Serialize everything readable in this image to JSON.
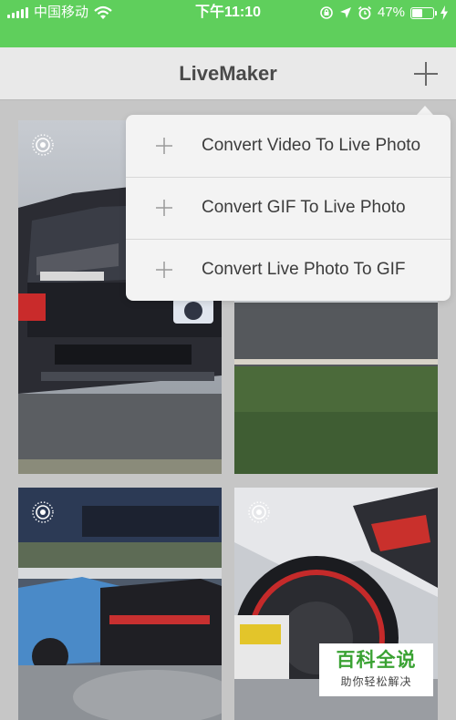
{
  "status_bar": {
    "carrier": "中国移动",
    "time": "下午11:10",
    "battery_percent": "47%",
    "battery_level": 0.47,
    "background_color": "#5fcf5c",
    "icons": [
      "signal-icon",
      "wifi-icon",
      "screen-lock-icon",
      "location-icon",
      "alarm-icon",
      "battery-icon",
      "charging-icon"
    ]
  },
  "nav": {
    "title": "LiveMaker",
    "add_icon": "plus-icon"
  },
  "menu": {
    "items": [
      {
        "label": "Convert Video To Live Photo",
        "icon": "plus-icon"
      },
      {
        "label": "Convert GIF To Live Photo",
        "icon": "plus-icon"
      },
      {
        "label": "Convert Live Photo To GIF",
        "icon": "plus-icon"
      }
    ]
  },
  "gallery": {
    "tiles": [
      {
        "badge_icon": "live-photo-icon",
        "subject": "drift car, front view"
      },
      {
        "badge_icon": "live-photo-icon",
        "subject": "drift car on track edge"
      },
      {
        "badge_icon": "live-photo-icon",
        "subject": "drift cars with smoke"
      },
      {
        "badge_icon": "live-photo-icon",
        "subject": "drift car wheel close-up"
      }
    ]
  },
  "watermark": {
    "main": "百科全说",
    "sub": "助你轻松解决"
  }
}
